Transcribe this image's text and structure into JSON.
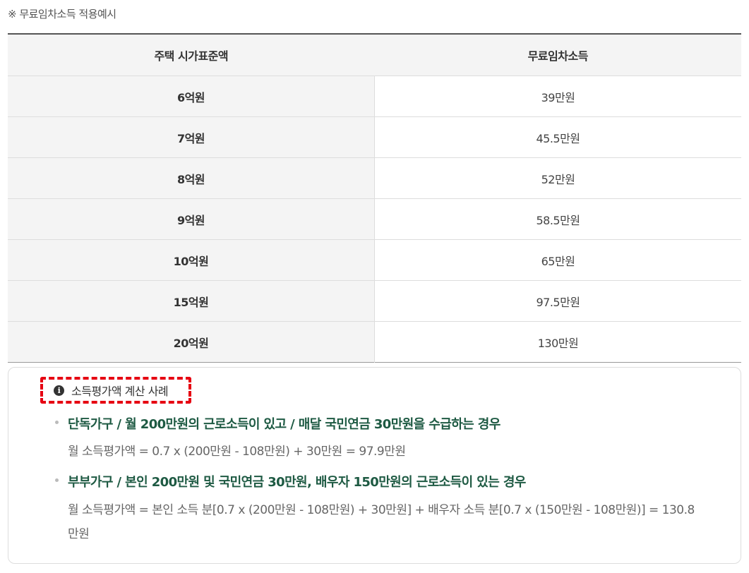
{
  "note": "※ 무료임차소득 적용예시",
  "table": {
    "headers": [
      "주택 시가표준액",
      "무료임차소득"
    ],
    "rows": [
      {
        "price": "6억원",
        "income": "39만원"
      },
      {
        "price": "7억원",
        "income": "45.5만원"
      },
      {
        "price": "8억원",
        "income": "52만원"
      },
      {
        "price": "9억원",
        "income": "58.5만원"
      },
      {
        "price": "10억원",
        "income": "65만원"
      },
      {
        "price": "15억원",
        "income": "97.5만원"
      },
      {
        "price": "20억원",
        "income": "130만원"
      }
    ]
  },
  "example": {
    "icon": "info-icon",
    "icon_glyph": "i",
    "title": "소득평가액 계산 사례",
    "highlight_color": "#e60012",
    "case_color": "#1e5a43",
    "cases": [
      {
        "heading": "단독가구 / 월 200만원의 근로소득이 있고 / 매달 국민연금 30만원을 수급하는 경우",
        "calc": "월 소득평가액 = 0.7 x (200만원 - 108만원) + 30만원 = 97.9만원"
      },
      {
        "heading": "부부가구 / 본인 200만원 및 국민연금 30만원, 배우자 150만원의 근로소득이 있는 경우",
        "calc": "월 소득평가액 = 본인 소득 분[0.7 x (200만원 - 108만원) + 30만원] + 배우자 소득 분[0.7 x (150만원 - 108만원)] = 130.8만원"
      }
    ]
  }
}
